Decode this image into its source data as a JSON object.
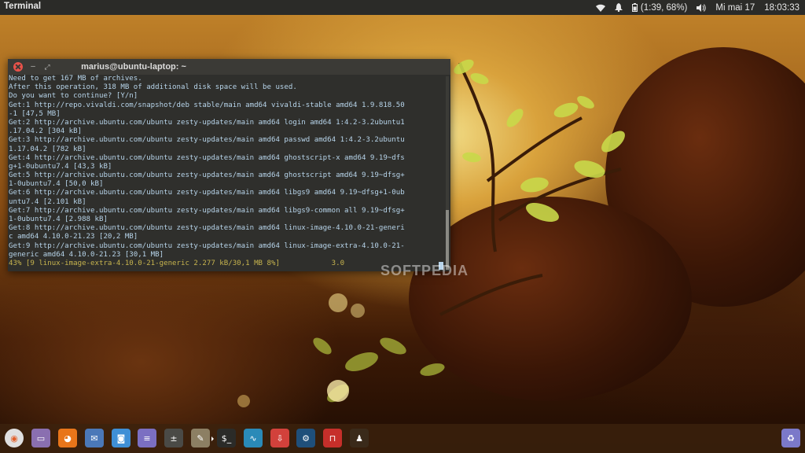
{
  "top_panel": {
    "app_title": "Terminal",
    "battery": "(1:39, 68%)",
    "date": "Mi mai 17",
    "time": "18:03:33"
  },
  "terminal": {
    "title": "marius@ubuntu-laptop: ~",
    "lines": [
      "Need to get 167 MB of archives.",
      "After this operation, 318 MB of additional disk space will be used.",
      "Do you want to continue? [Y/n]",
      "Get:1 http://repo.vivaldi.com/snapshot/deb stable/main amd64 vivaldi-stable amd64 1.9.818.50",
      "-1 [47,5 MB]",
      "Get:2 http://archive.ubuntu.com/ubuntu zesty-updates/main amd64 login amd64 1:4.2-3.2ubuntu1",
      ".17.04.2 [304 kB]",
      "Get:3 http://archive.ubuntu.com/ubuntu zesty-updates/main amd64 passwd amd64 1:4.2-3.2ubuntu",
      "1.17.04.2 [782 kB]",
      "Get:4 http://archive.ubuntu.com/ubuntu zesty-updates/main amd64 ghostscript-x amd64 9.19~dfs",
      "g+1-0ubuntu7.4 [43,3 kB]",
      "Get:5 http://archive.ubuntu.com/ubuntu zesty-updates/main amd64 ghostscript amd64 9.19~dfsg+",
      "1-0ubuntu7.4 [50,0 kB]",
      "Get:6 http://archive.ubuntu.com/ubuntu zesty-updates/main amd64 libgs9 amd64 9.19~dfsg+1-0ub",
      "untu7.4 [2.101 kB]",
      "Get:7 http://archive.ubuntu.com/ubuntu zesty-updates/main amd64 libgs9-common all 9.19~dfsg+",
      "1-0ubuntu7.4 [2.988 kB]",
      "Get:8 http://archive.ubuntu.com/ubuntu zesty-updates/main amd64 linux-image-4.10.0-21-generi",
      "c amd64 4.10.0-21.23 [20,2 MB]",
      "Get:9 http://archive.ubuntu.com/ubuntu zesty-updates/main amd64 linux-image-extra-4.10.0-21-",
      "generic amd64 4.10.0-21.23 [30,1 MB]"
    ],
    "progress_line": "43% [9 linux-image-extra-4.10.0-21-generic 2.277 kB/30,1 MB 8%]            3.0"
  },
  "watermark": "SOFTPEDIA",
  "dock": {
    "items": [
      {
        "name": "ubuntu-logo-icon",
        "glyph": "◉",
        "color": "#e0e0e0"
      },
      {
        "name": "files-icon",
        "glyph": "▭",
        "color": "#8a6fb0"
      },
      {
        "name": "firefox-icon",
        "glyph": "◕",
        "color": "#e8751a"
      },
      {
        "name": "mail-icon",
        "glyph": "✉",
        "color": "#4b78b8"
      },
      {
        "name": "screenshot-icon",
        "glyph": "◙",
        "color": "#3f8fd6"
      },
      {
        "name": "text-editor-icon",
        "glyph": "≡",
        "color": "#7b6fc2"
      },
      {
        "name": "calculator-icon",
        "glyph": "±",
        "color": "#4a4a46"
      },
      {
        "name": "gimp-icon",
        "glyph": "✎",
        "color": "#8c7f63"
      },
      {
        "name": "terminal-icon",
        "glyph": "$_",
        "color": "#2b2b28"
      },
      {
        "name": "system-monitor-icon",
        "glyph": "∿",
        "color": "#2a8ab8"
      },
      {
        "name": "software-updater-icon",
        "glyph": "⇩",
        "color": "#d2413b"
      },
      {
        "name": "steam-icon",
        "glyph": "⚙",
        "color": "#1f4f7a"
      },
      {
        "name": "transmission-icon",
        "glyph": "⊓",
        "color": "#c62f2a"
      },
      {
        "name": "pidgin-icon",
        "glyph": "♟",
        "color": "#3a2a1a"
      },
      {
        "name": "recycle-bin-icon",
        "glyph": "♻",
        "color": "#7b79c9"
      }
    ]
  }
}
